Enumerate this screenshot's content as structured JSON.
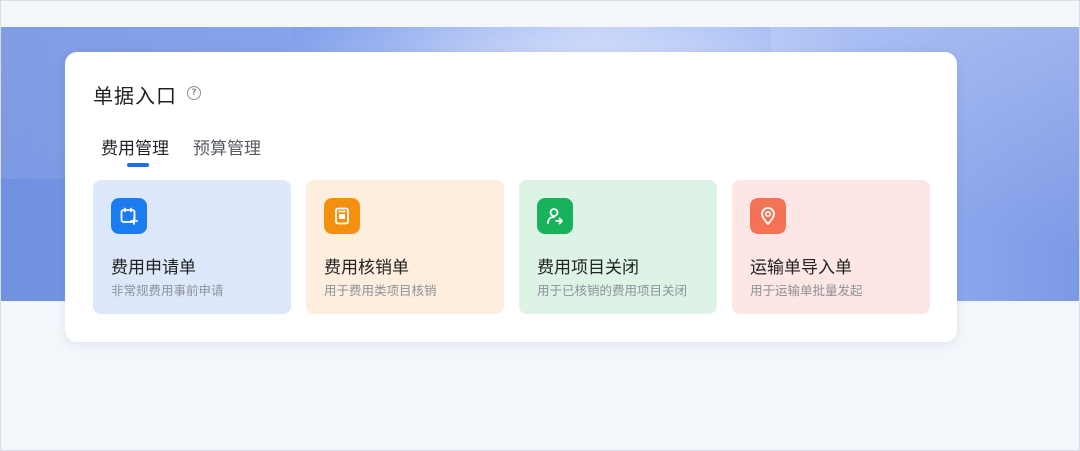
{
  "entry": {
    "title": "单据入口",
    "help_glyph": "?",
    "tabs": [
      {
        "label": "费用管理",
        "active": true
      },
      {
        "label": "预算管理",
        "active": false
      }
    ],
    "tiles": [
      {
        "title": "费用申请单",
        "desc": "非常规费用事前申请",
        "icon": "calendar-plus-icon",
        "bg": "#dde9fb",
        "icon_color": "#1a7cf0"
      },
      {
        "title": "费用核销单",
        "desc": "用于费用类项目核销",
        "icon": "document-icon",
        "bg": "#fdeede",
        "icon_color": "#f5900f"
      },
      {
        "title": "费用项目关闭",
        "desc": "用于已核销的费用项目关闭",
        "icon": "user-transfer-icon",
        "bg": "#ddf3e6",
        "icon_color": "#17b25b"
      },
      {
        "title": "运输单导入单",
        "desc": "用于运输单批量发起",
        "icon": "location-pin-icon",
        "bg": "#fde6e3",
        "icon_color": "#f47357"
      }
    ]
  },
  "colors": {
    "accent": "#1f6fe0",
    "hero": "#7f9ce8"
  }
}
